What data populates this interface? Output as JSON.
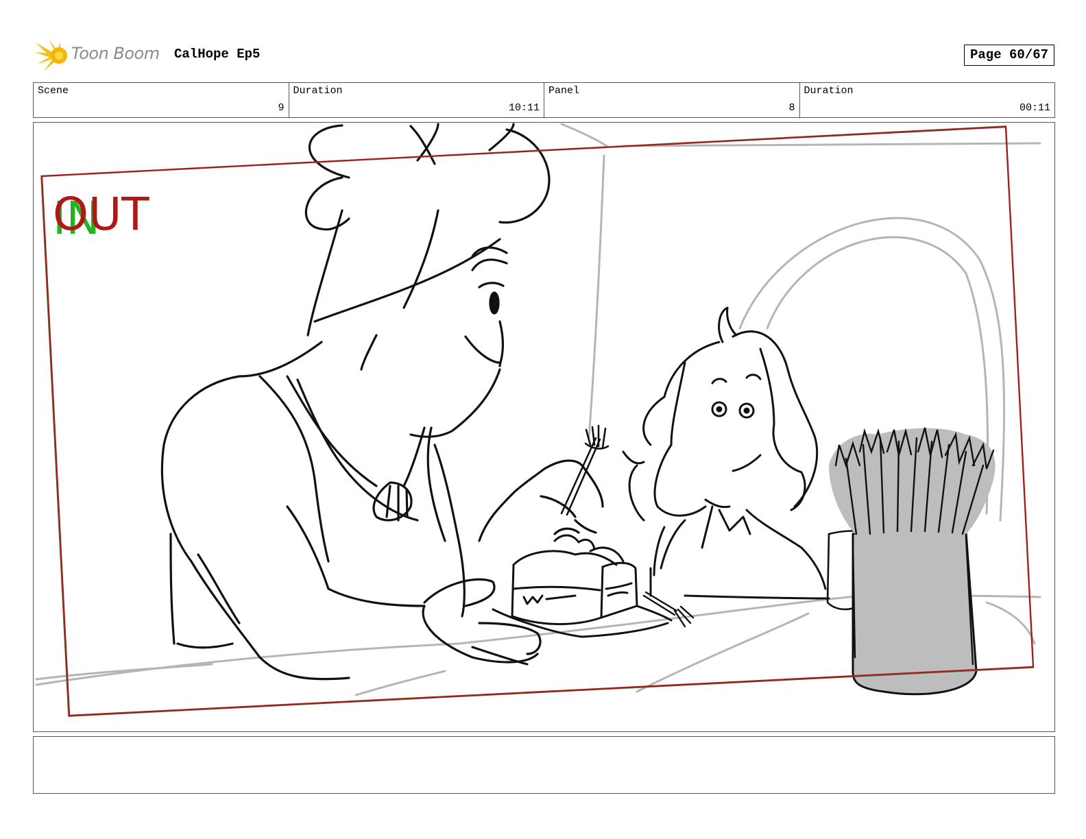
{
  "header": {
    "logo_text": "Toon Boom",
    "project_title": "CalHope Ep5",
    "page": "Page 60/67"
  },
  "info": {
    "scene_label": "Scene",
    "scene_value": "9",
    "duration_label": "Duration",
    "duration_value": "10:11",
    "panel_label": "Panel",
    "panel_value": "8",
    "panel_duration_label": "Duration",
    "panel_duration_value": "00:11"
  },
  "panel_art": {
    "in_marker": "IN",
    "out_marker": "OUT",
    "in_color": "#22b322",
    "out_color": "#b01818",
    "frame_color": "#a31f1f",
    "jar_fill": "#bdbdbd"
  },
  "notes": {
    "text": ""
  }
}
